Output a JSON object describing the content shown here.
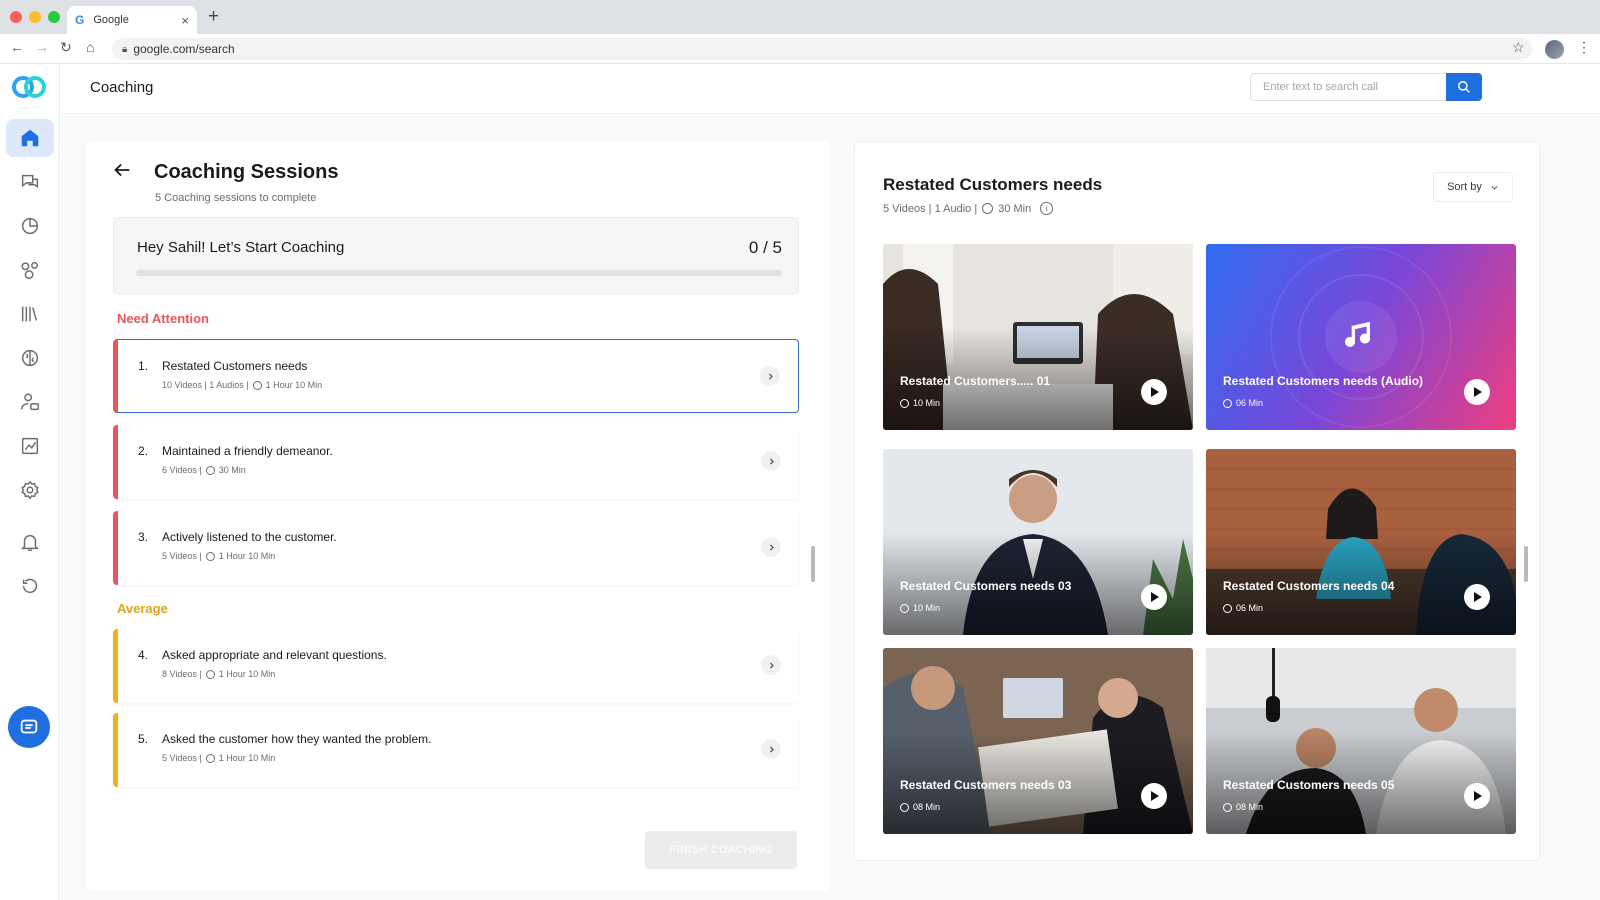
{
  "browser": {
    "tab_title": "Google",
    "tab_favicon": "G",
    "url": "google.com/search"
  },
  "header": {
    "title": "Coaching",
    "search_placeholder": "Enter text to search call"
  },
  "sidebar": {
    "items": [
      {
        "icon": "home-icon",
        "active": true
      },
      {
        "icon": "chat-icon",
        "active": false
      },
      {
        "icon": "pie-chart-icon",
        "active": false
      },
      {
        "icon": "team-circles-icon",
        "active": false
      },
      {
        "icon": "library-icon",
        "active": false
      },
      {
        "icon": "brain-icon",
        "active": false
      },
      {
        "icon": "user-settings-icon",
        "active": false
      },
      {
        "icon": "analytics-icon",
        "active": false
      },
      {
        "icon": "gear-icon",
        "active": false
      },
      {
        "icon": "bell-icon",
        "active": false
      },
      {
        "icon": "logout-icon",
        "active": false
      }
    ]
  },
  "coaching": {
    "title": "Coaching Sessions",
    "subtitle": "5 Coaching sessions to complete",
    "progress": {
      "greeting": "Hey Sahil! Let’s Start Coaching",
      "count": "0 / 5",
      "fraction": 0.0
    },
    "need_attention_label": "Need Attention",
    "average_label": "Average",
    "sessions": [
      {
        "num": "1.",
        "title": "Restated Customers needs",
        "videos": "10 Videos | 1 Audios |",
        "duration": "1 Hour 10 Min",
        "group": "attention",
        "selected": true
      },
      {
        "num": "2.",
        "title": "Maintained a friendly demeanor.",
        "videos": "6 Videos |",
        "duration": "30 Min",
        "group": "attention",
        "selected": false
      },
      {
        "num": "3.",
        "title": "Actively listened to the customer.",
        "videos": "5 Videos |",
        "duration": "1 Hour 10 Min",
        "group": "attention",
        "selected": false
      },
      {
        "num": "4.",
        "title": "Asked appropriate and relevant questions.",
        "videos": "8 Videos |",
        "duration": "1 Hour 10 Min",
        "group": "average",
        "selected": false
      },
      {
        "num": "5.",
        "title": "Asked the customer how they wanted the problem.",
        "videos": "5 Videos |",
        "duration": "1 Hour 10 Min",
        "group": "average",
        "selected": false
      }
    ],
    "finish_label": "FINISH COACHING"
  },
  "detail": {
    "title": "Restated Customers needs",
    "meta_counts": "5 Videos | 1 Audio |",
    "meta_duration": "30 Min",
    "sort_label": "Sort by",
    "media": [
      {
        "title": "Restated Customers..... 01",
        "duration": "10 Min",
        "kind": "video"
      },
      {
        "title": "Restated Customers needs (Audio)",
        "duration": "06 Min",
        "kind": "audio"
      },
      {
        "title": "Restated Customers needs 03",
        "duration": "10 Min",
        "kind": "video"
      },
      {
        "title": "Restated Customers needs 04",
        "duration": "06 Min",
        "kind": "video"
      },
      {
        "title": "Restated Customers needs 03",
        "duration": "08 Min",
        "kind": "video"
      },
      {
        "title": "Restated Customers needs 05",
        "duration": "08 Min",
        "kind": "video"
      }
    ]
  },
  "colors": {
    "accent": "#1f6fe0",
    "attention": "#e8565c",
    "average": "#f0b21a"
  }
}
